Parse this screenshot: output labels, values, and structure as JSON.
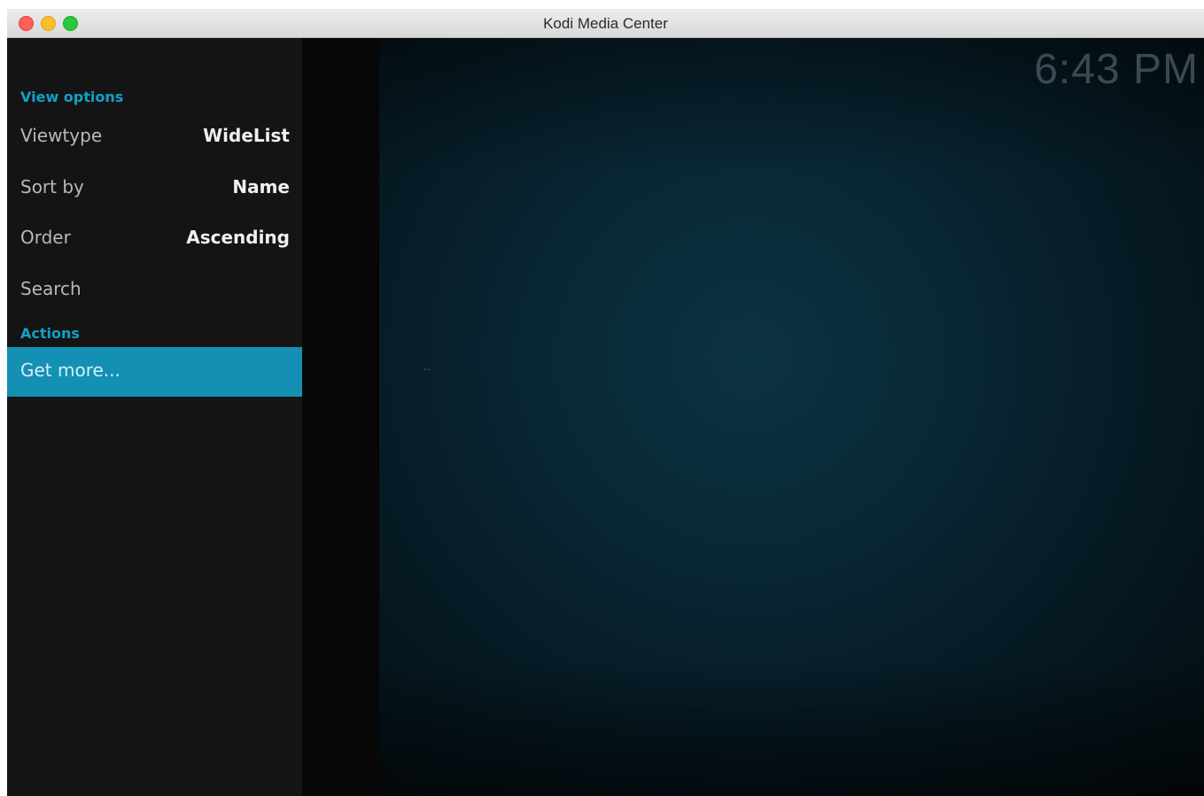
{
  "window": {
    "title": "Kodi Media Center"
  },
  "sidebar": {
    "view_options_header": "View options",
    "viewtype": {
      "label": "Viewtype",
      "value": "WideList"
    },
    "sort_by": {
      "label": "Sort by",
      "value": "Name"
    },
    "order": {
      "label": "Order",
      "value": "Ascending"
    },
    "search": {
      "label": "Search"
    },
    "actions_header": "Actions",
    "get_more": {
      "label": "Get more..."
    }
  },
  "content": {
    "clock": "6:43 PM",
    "parent_item": ".."
  },
  "colors": {
    "accent": "#12a0c7",
    "selected_row": "#1390b4",
    "sidebar_bg": "#141414",
    "content_bg": "#0c3344"
  },
  "icons": [
    "close-button",
    "minimize-button",
    "maximize-button"
  ]
}
